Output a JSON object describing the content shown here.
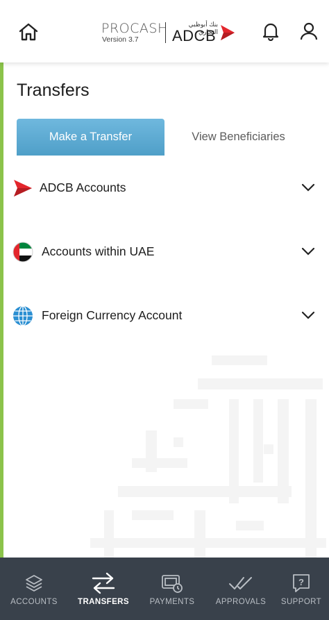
{
  "header": {
    "product": "PROCASH",
    "version": "Version 3.7",
    "bank_arabic": "بنك أبوظبي التجاري",
    "bank": "ADCB"
  },
  "page": {
    "title": "Transfers"
  },
  "tabs": [
    {
      "label": "Make a Transfer",
      "active": true
    },
    {
      "label": "View Beneficiaries",
      "active": false
    }
  ],
  "sections": [
    {
      "label": "ADCB Accounts",
      "icon": "adcb-logo-icon"
    },
    {
      "label": "Accounts within UAE",
      "icon": "uae-flag-icon"
    },
    {
      "label": "Foreign Currency Account",
      "icon": "globe-icon"
    }
  ],
  "bottom_nav": [
    {
      "label": "ACCOUNTS",
      "icon": "layers-icon",
      "active": false
    },
    {
      "label": "TRANSFERS",
      "icon": "transfer-arrows-icon",
      "active": true
    },
    {
      "label": "PAYMENTS",
      "icon": "payments-icon",
      "active": false
    },
    {
      "label": "APPROVALS",
      "icon": "double-check-icon",
      "active": false
    },
    {
      "label": "SUPPORT",
      "icon": "help-icon",
      "active": false
    }
  ],
  "colors": {
    "accent_bar": "#8bc34a",
    "tab_active": "#5aaad4",
    "nav_bg": "#39414b",
    "brand_red": "#e3262c"
  }
}
